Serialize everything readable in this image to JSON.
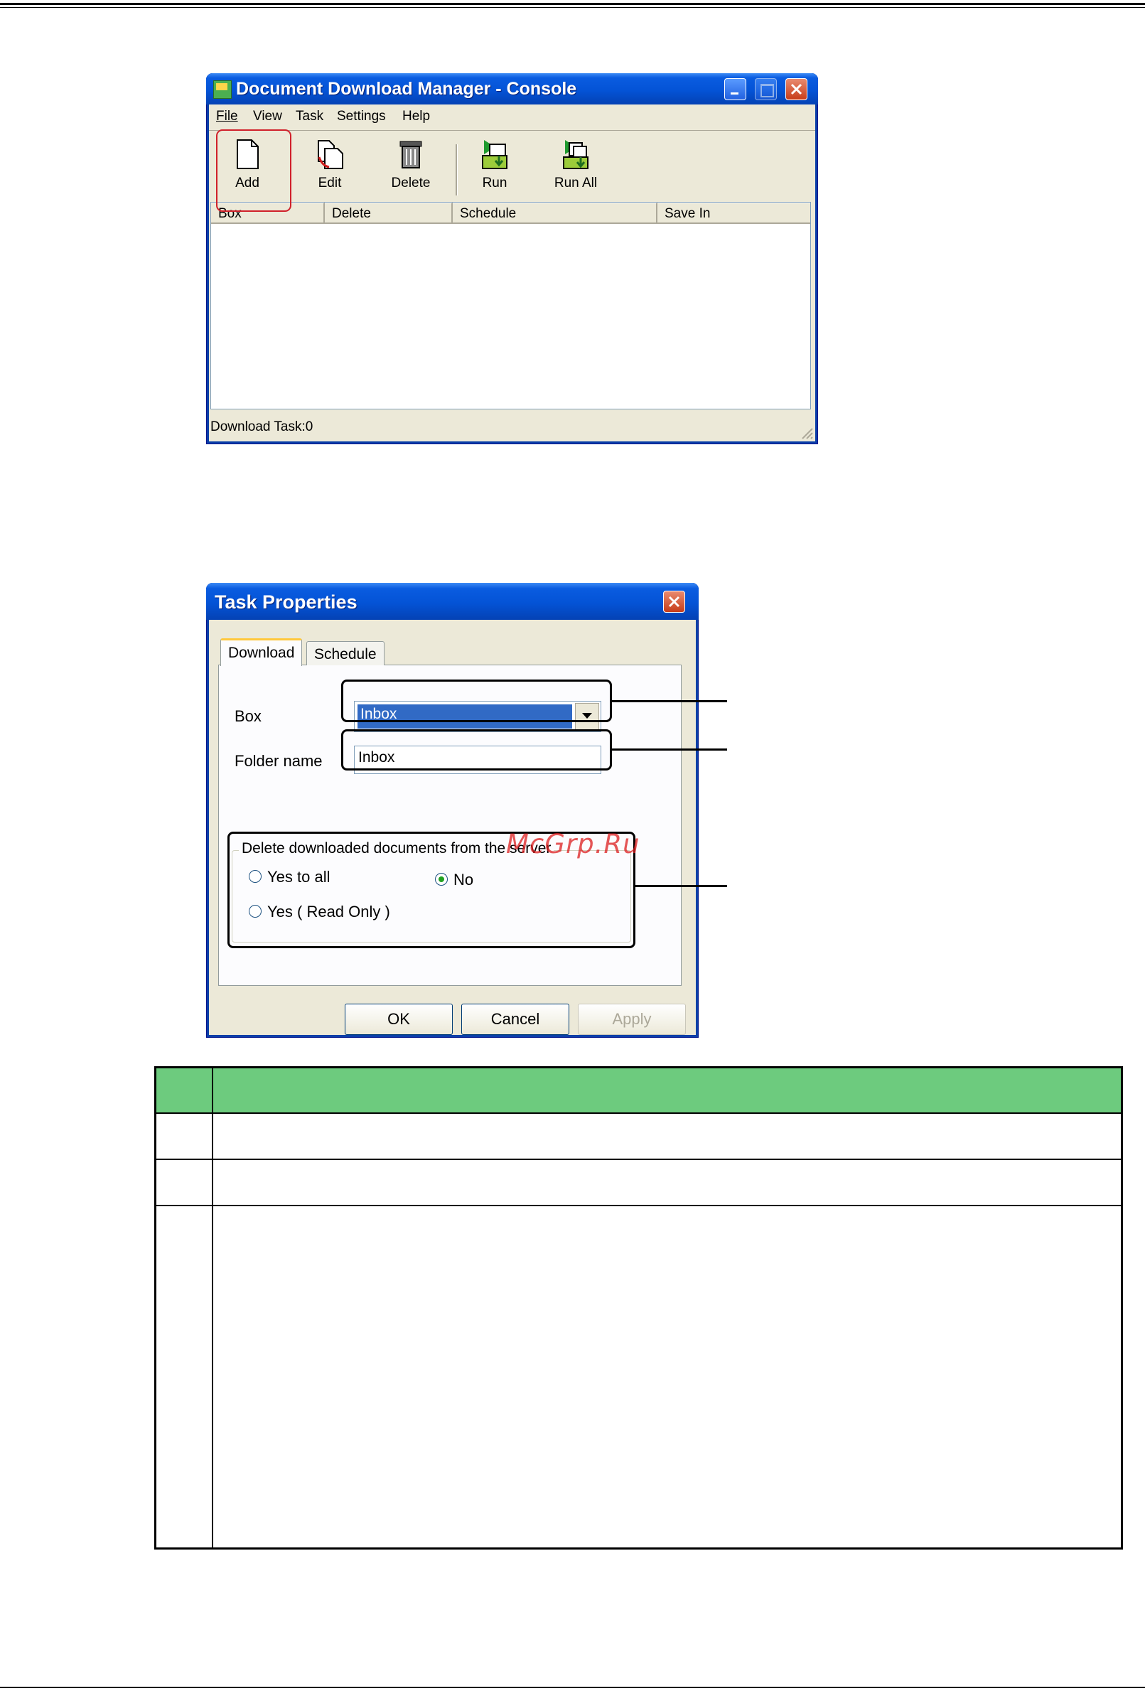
{
  "console_window": {
    "title": "Document Download Manager - Console",
    "menu": [
      "File",
      "View",
      "Task",
      "Settings",
      "Help"
    ],
    "toolbar": {
      "add": "Add",
      "edit": "Edit",
      "delete": "Delete",
      "run": "Run",
      "run_all": "Run All"
    },
    "columns": [
      "Box",
      "Delete",
      "Schedule",
      "Save In"
    ],
    "status": "Download Task:0"
  },
  "task_dialog": {
    "title": "Task Properties",
    "tabs": [
      "Download",
      "Schedule"
    ],
    "box_label": "Box",
    "box_value": "Inbox",
    "folder_label": "Folder name",
    "folder_value": "Inbox",
    "group_title": "Delete downloaded documents from the server",
    "radio_yes_all": "Yes to all",
    "radio_no": "No",
    "radio_yes_readonly": "Yes ( Read Only )",
    "ok": "OK",
    "cancel": "Cancel",
    "apply": "Apply"
  },
  "watermark": "McGrp.Ru",
  "colors": {
    "table_header": "#6dcb7e",
    "highlight": "#d0202a"
  }
}
